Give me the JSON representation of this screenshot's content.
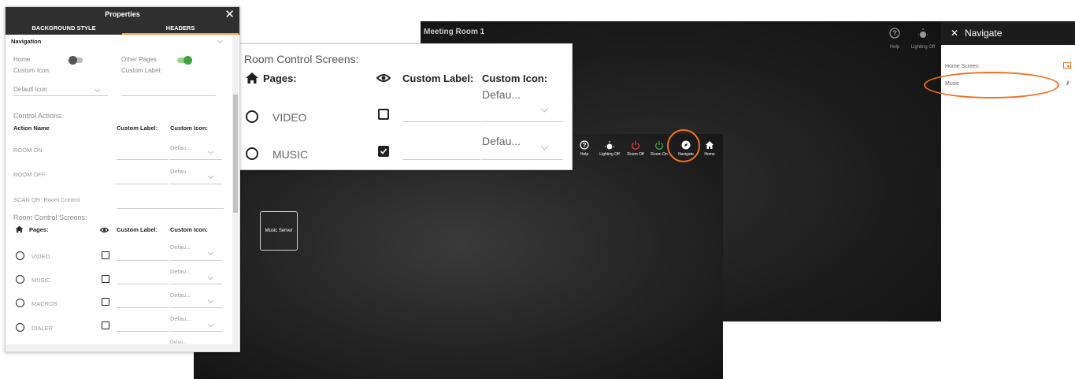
{
  "back_room": {
    "title": "Meeting Room 1",
    "help_label": "Help",
    "lighting_label": "Lighting Off",
    "nav_panel": {
      "title": "Navigate",
      "items": [
        {
          "label": "Home Screen",
          "icon": "home-screen-icon"
        },
        {
          "label": "Music",
          "icon": "music-note-icon"
        }
      ]
    }
  },
  "front_room": {
    "toolbar": [
      {
        "label": "Help",
        "icon": "help-icon"
      },
      {
        "label": "Lighting Off",
        "icon": "lightbulb-icon"
      },
      {
        "label": "Room Off",
        "icon": "power-icon"
      },
      {
        "label": "Room On",
        "icon": "power-icon"
      },
      {
        "label": "Navigate",
        "icon": "compass-icon"
      },
      {
        "label": "Home",
        "icon": "home-icon"
      }
    ],
    "tile": "Music Server",
    "colors": {
      "room_off": "#e03c31",
      "room_on": "#3fa33f",
      "highlight": "#f07020"
    }
  },
  "zoom_card": {
    "title": "Room Control Screens:",
    "pages_header": "Pages:",
    "custom_label_header": "Custom Label:",
    "custom_icon_header": "Custom Icon:",
    "rows": [
      {
        "label": "VIDEO",
        "checked": false,
        "icon_value": "Defau..."
      },
      {
        "label": "MUSIC",
        "checked": true,
        "icon_value": "Defau..."
      }
    ]
  },
  "properties": {
    "title": "Properties",
    "tabs": [
      "BACKGROUND STYLE",
      "HEADERS"
    ],
    "active_tab": "HEADERS",
    "section": "Navigation",
    "home_label": "Home",
    "other_pages_label": "Other Pages",
    "custom_icon_label": "Custom Icon:",
    "custom_label_label": "Custom Label:",
    "default_icon": "Default Icon",
    "control_actions_label": "Control Actions:",
    "action_name_header": "Action Name",
    "custom_label_header": "Custom Label:",
    "custom_icon_header": "Custom Icon:",
    "actions": [
      {
        "label": "ROOM ON",
        "icon_value": "Defau..."
      },
      {
        "label": "ROOM OFF",
        "icon_value": "Defau..."
      },
      {
        "label": "SCAN QR: Room Control",
        "icon_value": ""
      }
    ],
    "room_control_screens_label": "Room Control Screens:",
    "pages_header": "Pages:",
    "pages": [
      {
        "label": "VIDEO",
        "icon_value": "Defau..."
      },
      {
        "label": "MUSIC",
        "icon_value": "Defau..."
      },
      {
        "label": "MACROS",
        "icon_value": "Defau..."
      },
      {
        "label": "DIALER",
        "icon_value": "Defau..."
      }
    ],
    "cut_value": "Defau...",
    "accent": "#ff9933"
  }
}
